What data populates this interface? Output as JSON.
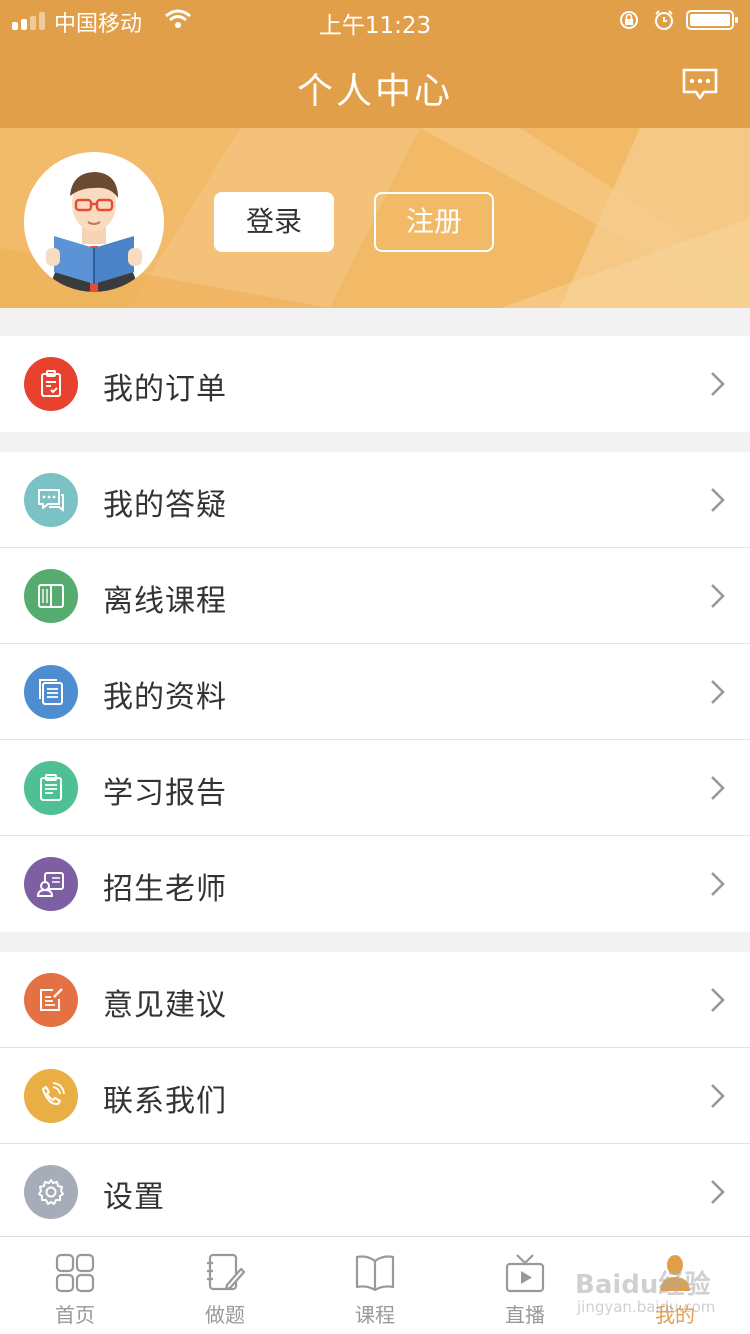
{
  "status_bar": {
    "carrier": "中国移动",
    "time": "上午11:23"
  },
  "header": {
    "title": "个人中心",
    "message_icon": "message-icon"
  },
  "profile": {
    "avatar_icon": "reader-avatar-icon",
    "login_label": "登录",
    "register_label": "注册"
  },
  "colors": {
    "primary": "#e29f4a",
    "banner": "#efb460"
  },
  "menu": {
    "items": [
      {
        "label": "我的订单",
        "icon": "clipboard-icon",
        "color": "#e8412e"
      },
      {
        "label": "我的答疑",
        "icon": "chat-icon",
        "color": "#7bc2c4"
      },
      {
        "label": "离线课程",
        "icon": "book-icon",
        "color": "#55ac6e"
      },
      {
        "label": "我的资料",
        "icon": "documents-icon",
        "color": "#4e8ed0"
      },
      {
        "label": "学习报告",
        "icon": "report-icon",
        "color": "#4fbf94"
      },
      {
        "label": "招生老师",
        "icon": "teacher-icon",
        "color": "#7f5fa3"
      },
      {
        "label": "意见建议",
        "icon": "feedback-icon",
        "color": "#e37144"
      },
      {
        "label": "联系我们",
        "icon": "phone-icon",
        "color": "#eaaf44"
      },
      {
        "label": "设置",
        "icon": "gear-icon",
        "color": "#a6adb8"
      }
    ]
  },
  "tabbar": {
    "tabs": [
      {
        "label": "首页",
        "icon": "home-grid-icon"
      },
      {
        "label": "做题",
        "icon": "notebook-pen-icon"
      },
      {
        "label": "课程",
        "icon": "open-book-icon"
      },
      {
        "label": "直播",
        "icon": "tv-play-icon"
      },
      {
        "label": "我的",
        "icon": "person-icon",
        "active": true
      }
    ]
  },
  "watermark": {
    "text": "Baidu经验",
    "sub": "jingyan.baidu.com"
  }
}
